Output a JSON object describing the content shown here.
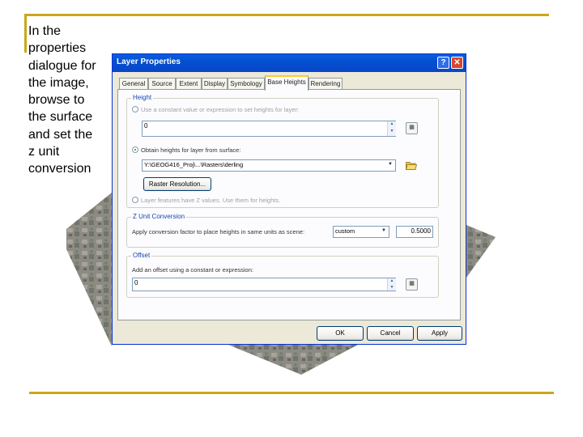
{
  "slide": {
    "caption": "In the\nproperties\ndialogue for\nthe image,\nbrowse to\nthe surface\nand set the\nz unit\nconversion",
    "accent_color": "#c9a81a"
  },
  "dialog": {
    "title": "Layer Properties",
    "help_glyph": "?",
    "close_glyph": "✕",
    "tabs": [
      "General",
      "Source",
      "Extent",
      "Display",
      "Symbology",
      "Base Heights",
      "Rendering"
    ],
    "active_tab": "Base Heights",
    "height_group": {
      "legend": "Height",
      "option_constant": "Use a constant value or expression to set heights for layer:",
      "constant_value": "0",
      "option_surface": "Obtain heights for layer from surface:",
      "surface_path": "Y:\\GEOG416_Proj\\...\\Rasters\\derling",
      "raster_resolution_button": "Raster Resolution...",
      "option_z_values": "Layer features have Z values. Use them for heights."
    },
    "z_unit_group": {
      "legend": "Z Unit Conversion",
      "label": "Apply conversion factor to place heights in same units as scene:",
      "unit_selected": "custom",
      "factor": "0.5000"
    },
    "offset_group": {
      "legend": "Offset",
      "label": "Add an offset using a constant or expression:",
      "value": "0"
    },
    "buttons": {
      "ok": "OK",
      "cancel": "Cancel",
      "apply": "Apply"
    }
  }
}
